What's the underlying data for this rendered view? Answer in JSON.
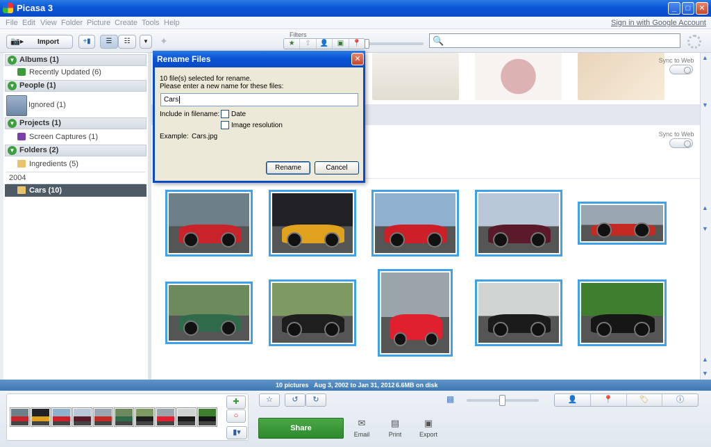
{
  "window": {
    "title": "Picasa 3",
    "minimize": "_",
    "maximize": "□",
    "close": "✕"
  },
  "menu": {
    "items": [
      "File",
      "Edit",
      "View",
      "Folder",
      "Picture",
      "Create",
      "Tools",
      "Help"
    ],
    "signin": "Sign in with Google Account"
  },
  "toolbar": {
    "import_label": "Import",
    "filters_label": "Filters",
    "search_value": ""
  },
  "sidebar": {
    "albums_header": "Albums (1)",
    "recently_updated": "Recently Updated (6)",
    "people_header": "People (1)",
    "ignored": "Ignored (1)",
    "projects_header": "Projects (1)",
    "screen_captures": "Screen Captures (1)",
    "folders_header": "Folders (2)",
    "ingredients": "Ingredients (5)",
    "year": "2004",
    "cars": "Cars (10)"
  },
  "main": {
    "sync_label": "Sync to Web"
  },
  "dialog": {
    "title": "Rename Files",
    "line1": "10 file(s) selected for rename.",
    "line2": "Please enter a new name for these files:",
    "name_value": "Cars",
    "include_label": "Include in filename:",
    "date_label": "Date",
    "resolution_label": "Image resolution",
    "example_label": "Example:",
    "example_value": "Cars.jpg",
    "rename_button": "Rename",
    "cancel_button": "Cancel",
    "date_checked": false,
    "resolution_checked": false
  },
  "status": {
    "count": "10 pictures",
    "dates": "Aug 3, 2002 to Jan 31, 2012",
    "size": "6.6MB on disk"
  },
  "tray": {
    "share": "Share",
    "email": "Email",
    "print": "Print",
    "export": "Export"
  },
  "colors": {
    "accent": "#3fa2e8",
    "title_blue": "#0a55d8",
    "share_green": "#3a9a38",
    "selected_row": "#4f5a67"
  },
  "photos": [
    {
      "name": "red-classic-coupe",
      "bg": "#6d7f88",
      "car": "#c8232b"
    },
    {
      "name": "orange-muscle-car",
      "bg": "#222226",
      "car": "#e0a21c"
    },
    {
      "name": "red-chevy-open-hood",
      "bg": "#8fb1cf",
      "car": "#cc1f27"
    },
    {
      "name": "burgundy-chevy",
      "bg": "#b8c8d8",
      "car": "#5a1a2a"
    },
    {
      "name": "red-chevelle",
      "bg": "#9aa7b0",
      "car": "#c42a22"
    },
    {
      "name": "green-car-rear",
      "bg": "#6d8a5c",
      "car": "#2f6a4a"
    },
    {
      "name": "black-model-t",
      "bg": "#7e9a62",
      "car": "#1e1e1e"
    },
    {
      "name": "red-viper",
      "bg": "#9aa4aa",
      "car": "#e0202e"
    },
    {
      "name": "black-roadster",
      "bg": "#cfd3d2",
      "car": "#1b1b1b"
    },
    {
      "name": "black-hot-rod",
      "bg": "#3f7d2f",
      "car": "#161616"
    }
  ]
}
